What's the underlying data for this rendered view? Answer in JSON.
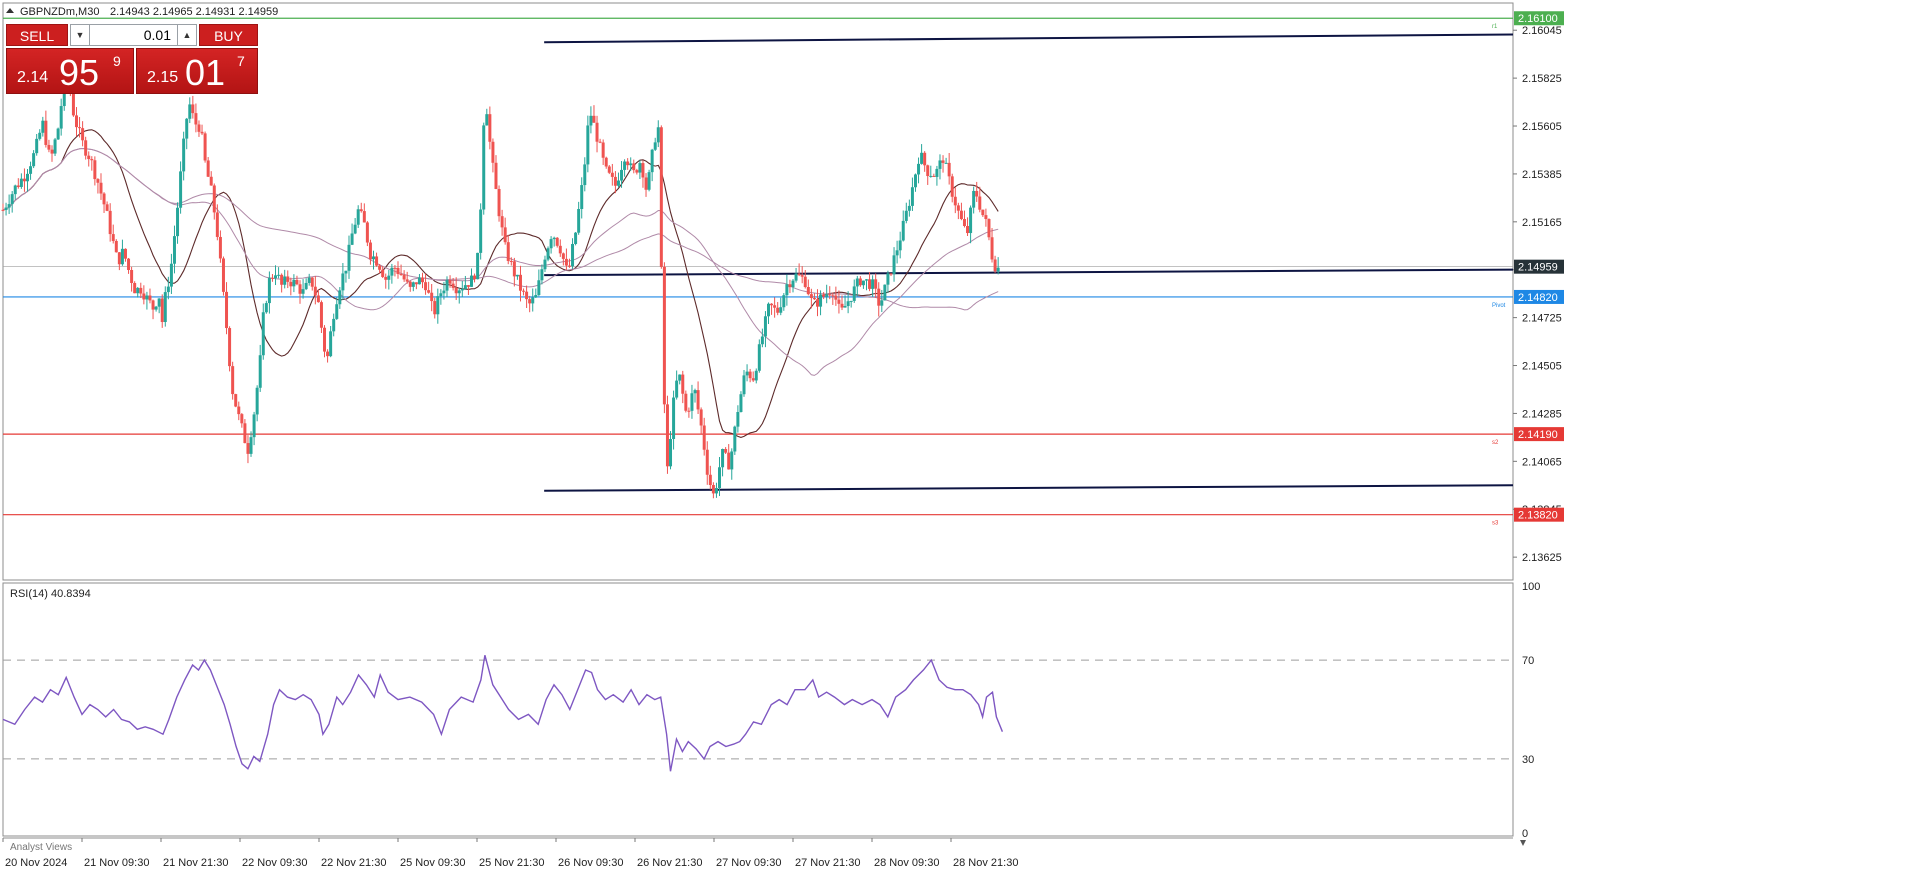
{
  "header": {
    "symbol": "GBPNZDm,M30",
    "ohlc": "2.14943 2.14965 2.14931 2.14959"
  },
  "trade_panel": {
    "sell_label": "SELL",
    "buy_label": "BUY",
    "lot": "0.01",
    "bid_small": "2.14",
    "bid_big": "95",
    "bid_sup": "9",
    "ask_small": "2.15",
    "ask_big": "01",
    "ask_sup": "7"
  },
  "indicator_label": "RSI(14) 40.8394",
  "bottom_tab": "Analyst Views",
  "colors": {
    "bull": "#26a69a",
    "bear": "#ef5350",
    "level_green": "#4caf50",
    "level_blue": "#1e88e5",
    "level_red": "#e53935",
    "channel": "#0d1442",
    "rsi": "#7e57c2",
    "ma_dark": "#5d2a2a",
    "ma_light": "#b08aa8"
  },
  "chart_data": [
    {
      "type": "candlestick",
      "x": [
        "20 Nov 2024",
        "21 Nov 09:30",
        "21 Nov 21:30",
        "22 Nov 09:30",
        "22 Nov 21:30",
        "25 Nov 09:30",
        "25 Nov 21:30",
        "26 Nov 09:30",
        "26 Nov 21:30",
        "27 Nov 09:30",
        "27 Nov 21:30",
        "28 Nov 09:30",
        "28 Nov 21:30"
      ],
      "ylim": [
        2.1352,
        2.1617
      ],
      "y_ticks": [
        "2.16045",
        "2.15825",
        "2.15605",
        "2.15385",
        "2.15165",
        "2.14945",
        "2.14725",
        "2.14505",
        "2.14285",
        "2.14065",
        "2.13845",
        "2.13625"
      ],
      "last_price": 2.14959,
      "levels": [
        {
          "label": "2.16100",
          "value": 2.161,
          "color": "#4caf50",
          "tag": "r1"
        },
        {
          "label": "2.14820",
          "value": 2.1482,
          "color": "#1e88e5",
          "tag": "Pivot"
        },
        {
          "label": "2.14190",
          "value": 2.1419,
          "color": "#e53935",
          "tag": "s2"
        },
        {
          "label": "2.13820",
          "value": 2.1382,
          "color": "#e53935",
          "tag": "s3"
        }
      ],
      "channel_lines": [
        {
          "from": [
            13.7,
            2.1599
          ],
          "to": [
            62,
            2.1606
          ]
        },
        {
          "from": [
            13.7,
            2.1492
          ],
          "to": [
            62,
            2.1497
          ]
        },
        {
          "from": [
            13.7,
            2.1393
          ],
          "to": [
            62,
            2.1398
          ]
        }
      ],
      "path": [
        [
          0,
          2.1522
        ],
        [
          0.3,
          2.1532
        ],
        [
          0.55,
          2.1538
        ],
        [
          0.8,
          2.1548
        ],
        [
          1,
          2.1562
        ],
        [
          1.2,
          2.1544
        ],
        [
          1.4,
          2.156
        ],
        [
          1.6,
          2.1588
        ],
        [
          1.8,
          2.1565
        ],
        [
          2,
          2.1553
        ],
        [
          2.2,
          2.1546
        ],
        [
          2.4,
          2.1535
        ],
        [
          2.6,
          2.1522
        ],
        [
          2.75,
          2.151
        ],
        [
          2.9,
          2.1498
        ],
        [
          3.05,
          2.1503
        ],
        [
          3.2,
          2.1493
        ],
        [
          3.35,
          2.1485
        ],
        [
          3.5,
          2.1486
        ],
        [
          3.65,
          2.1481
        ],
        [
          3.8,
          2.1477
        ],
        [
          3.95,
          2.1483
        ],
        [
          4.05,
          2.1468
        ],
        [
          4.1,
          2.1481
        ],
        [
          4.25,
          2.1495
        ],
        [
          4.4,
          2.152
        ],
        [
          4.55,
          2.1548
        ],
        [
          4.7,
          2.1572
        ],
        [
          4.85,
          2.1562
        ],
        [
          5,
          2.156
        ],
        [
          5.1,
          2.1545
        ],
        [
          5.3,
          2.1528
        ],
        [
          5.45,
          2.1508
        ],
        [
          5.55,
          2.1488
        ],
        [
          5.65,
          2.147
        ],
        [
          5.8,
          2.144
        ],
        [
          5.95,
          2.1428
        ],
        [
          6.1,
          2.1418
        ],
        [
          6.2,
          2.1412
        ],
        [
          6.35,
          2.1428
        ],
        [
          6.5,
          2.145
        ],
        [
          6.6,
          2.1475
        ],
        [
          6.75,
          2.149
        ],
        [
          6.9,
          2.1494
        ],
        [
          7.05,
          2.1487
        ],
        [
          7.2,
          2.149
        ],
        [
          7.4,
          2.1488
        ],
        [
          7.6,
          2.1484
        ],
        [
          7.8,
          2.149
        ],
        [
          8,
          2.1478
        ],
        [
          8.1,
          2.1462
        ],
        [
          8.2,
          2.1452
        ],
        [
          8.35,
          2.1473
        ],
        [
          8.5,
          2.1486
        ],
        [
          8.7,
          2.1497
        ],
        [
          8.85,
          2.1512
        ],
        [
          9,
          2.1522
        ],
        [
          9.15,
          2.1515
        ],
        [
          9.3,
          2.1502
        ],
        [
          9.5,
          2.1498
        ],
        [
          9.7,
          2.149
        ],
        [
          9.9,
          2.1496
        ],
        [
          10.1,
          2.1492
        ],
        [
          10.3,
          2.1485
        ],
        [
          10.5,
          2.149
        ],
        [
          10.7,
          2.1488
        ],
        [
          10.9,
          2.1474
        ],
        [
          11.1,
          2.1485
        ],
        [
          11.3,
          2.1491
        ],
        [
          11.5,
          2.1486
        ],
        [
          11.7,
          2.1488
        ],
        [
          11.9,
          2.149
        ],
        [
          12.05,
          2.1502
        ],
        [
          12.2,
          2.1578
        ],
        [
          12.35,
          2.1548
        ],
        [
          12.5,
          2.1528
        ],
        [
          12.7,
          2.1505
        ],
        [
          12.9,
          2.1495
        ],
        [
          13.1,
          2.1486
        ],
        [
          13.3,
          2.1478
        ],
        [
          13.5,
          2.1482
        ],
        [
          13.7,
          2.15
        ],
        [
          13.9,
          2.1512
        ],
        [
          14.1,
          2.1505
        ],
        [
          14.3,
          2.1492
        ],
        [
          14.5,
          2.1512
        ],
        [
          14.7,
          2.1538
        ],
        [
          14.85,
          2.1568
        ],
        [
          15.05,
          2.1555
        ],
        [
          15.25,
          2.154
        ],
        [
          15.5,
          2.1533
        ],
        [
          15.75,
          2.1548
        ],
        [
          15.95,
          2.1538
        ],
        [
          16.15,
          2.1545
        ],
        [
          16.3,
          2.153
        ],
        [
          16.5,
          2.1555
        ],
        [
          16.6,
          2.156
        ],
        [
          16.7,
          2.146
        ],
        [
          16.8,
          2.1398
        ],
        [
          16.95,
          2.143
        ],
        [
          17.1,
          2.1448
        ],
        [
          17.3,
          2.1428
        ],
        [
          17.5,
          2.144
        ],
        [
          17.7,
          2.142
        ],
        [
          17.85,
          2.14
        ],
        [
          18,
          2.139
        ],
        [
          18.2,
          2.141
        ],
        [
          18.4,
          2.1405
        ],
        [
          18.6,
          2.143
        ],
        [
          18.8,
          2.1448
        ],
        [
          19,
          2.1445
        ],
        [
          19.2,
          2.1462
        ],
        [
          19.4,
          2.1478
        ],
        [
          19.6,
          2.1475
        ],
        [
          19.85,
          2.1488
        ],
        [
          20.05,
          2.1492
        ],
        [
          20.3,
          2.149
        ],
        [
          20.5,
          2.1478
        ],
        [
          20.75,
          2.1482
        ],
        [
          21,
          2.1486
        ],
        [
          21.2,
          2.1474
        ],
        [
          21.45,
          2.1482
        ],
        [
          21.7,
          2.149
        ],
        [
          22,
          2.1488
        ],
        [
          22.2,
          2.1478
        ],
        [
          22.4,
          2.149
        ],
        [
          22.6,
          2.1502
        ],
        [
          22.8,
          2.1515
        ],
        [
          23,
          2.153
        ],
        [
          23.2,
          2.1548
        ],
        [
          23.4,
          2.154
        ],
        [
          23.6,
          2.1538
        ],
        [
          23.8,
          2.1546
        ],
        [
          24,
          2.1532
        ],
        [
          24.2,
          2.152
        ],
        [
          24.4,
          2.151
        ],
        [
          24.6,
          2.1532
        ],
        [
          24.8,
          2.152
        ],
        [
          24.9,
          2.1515
        ],
        [
          25.05,
          2.15
        ],
        [
          25.15,
          2.1495
        ],
        [
          25.3,
          2.1496
        ]
      ]
    },
    {
      "type": "line",
      "title": "RSI(14) 40.8394",
      "ylim": [
        0,
        100
      ],
      "y_ticks": [
        100,
        70,
        30,
        0
      ],
      "levels": [
        70,
        30
      ],
      "series": [
        {
          "values": [
            [
              0,
              46
            ],
            [
              0.3,
              44
            ],
            [
              0.55,
              50
            ],
            [
              0.8,
              55
            ],
            [
              1,
              53
            ],
            [
              1.2,
              58
            ],
            [
              1.4,
              56
            ],
            [
              1.6,
              63
            ],
            [
              1.8,
              55
            ],
            [
              2,
              48
            ],
            [
              2.2,
              52
            ],
            [
              2.4,
              50
            ],
            [
              2.6,
              47
            ],
            [
              2.8,
              50
            ],
            [
              3,
              46
            ],
            [
              3.2,
              45
            ],
            [
              3.4,
              42
            ],
            [
              3.6,
              43
            ],
            [
              3.8,
              42
            ],
            [
              4.05,
              40
            ],
            [
              4.2,
              46
            ],
            [
              4.4,
              55
            ],
            [
              4.6,
              62
            ],
            [
              4.8,
              68
            ],
            [
              4.95,
              66
            ],
            [
              5.1,
              70
            ],
            [
              5.25,
              66
            ],
            [
              5.4,
              60
            ],
            [
              5.6,
              52
            ],
            [
              5.75,
              44
            ],
            [
              5.9,
              35
            ],
            [
              6.05,
              28
            ],
            [
              6.2,
              26
            ],
            [
              6.35,
              31
            ],
            [
              6.5,
              29
            ],
            [
              6.7,
              40
            ],
            [
              6.85,
              52
            ],
            [
              7,
              58
            ],
            [
              7.2,
              55
            ],
            [
              7.4,
              54
            ],
            [
              7.6,
              56
            ],
            [
              7.8,
              54
            ],
            [
              8,
              48
            ],
            [
              8.1,
              40
            ],
            [
              8.25,
              44
            ],
            [
              8.45,
              55
            ],
            [
              8.6,
              52
            ],
            [
              8.8,
              57
            ],
            [
              9,
              64
            ],
            [
              9.2,
              60
            ],
            [
              9.4,
              55
            ],
            [
              9.55,
              64
            ],
            [
              9.75,
              57
            ],
            [
              10,
              54
            ],
            [
              10.3,
              55
            ],
            [
              10.6,
              53
            ],
            [
              10.9,
              48
            ],
            [
              11.1,
              40
            ],
            [
              11.3,
              50
            ],
            [
              11.6,
              55
            ],
            [
              11.9,
              53
            ],
            [
              12.1,
              62
            ],
            [
              12.2,
              72
            ],
            [
              12.4,
              60
            ],
            [
              12.6,
              55
            ],
            [
              12.8,
              50
            ],
            [
              13.05,
              46
            ],
            [
              13.3,
              48
            ],
            [
              13.55,
              44
            ],
            [
              13.75,
              54
            ],
            [
              13.95,
              60
            ],
            [
              14.15,
              56
            ],
            [
              14.35,
              50
            ],
            [
              14.55,
              58
            ],
            [
              14.75,
              66
            ],
            [
              14.9,
              65
            ],
            [
              15.05,
              58
            ],
            [
              15.25,
              54
            ],
            [
              15.45,
              56
            ],
            [
              15.7,
              53
            ],
            [
              15.9,
              58
            ],
            [
              16.1,
              52
            ],
            [
              16.3,
              56
            ],
            [
              16.5,
              54
            ],
            [
              16.65,
              55
            ],
            [
              16.8,
              40
            ],
            [
              16.9,
              25
            ],
            [
              17.05,
              38
            ],
            [
              17.2,
              33
            ],
            [
              17.35,
              37
            ],
            [
              17.55,
              34
            ],
            [
              17.75,
              30
            ],
            [
              17.9,
              35
            ],
            [
              18.1,
              37
            ],
            [
              18.3,
              35
            ],
            [
              18.5,
              36
            ],
            [
              18.65,
              37
            ],
            [
              18.8,
              40
            ],
            [
              19,
              45
            ],
            [
              19.2,
              44
            ],
            [
              19.45,
              52
            ],
            [
              19.65,
              54
            ],
            [
              19.85,
              52
            ],
            [
              20.05,
              58
            ],
            [
              20.3,
              58
            ],
            [
              20.5,
              62
            ],
            [
              20.65,
              55
            ],
            [
              20.85,
              57
            ],
            [
              21.05,
              55
            ],
            [
              21.3,
              52
            ],
            [
              21.5,
              54
            ],
            [
              21.75,
              52
            ],
            [
              22,
              54
            ],
            [
              22.2,
              52
            ],
            [
              22.4,
              47
            ],
            [
              22.6,
              55
            ],
            [
              22.85,
              58
            ],
            [
              23.05,
              62
            ],
            [
              23.3,
              66
            ],
            [
              23.5,
              70
            ],
            [
              23.7,
              62
            ],
            [
              23.9,
              59
            ],
            [
              24.1,
              58
            ],
            [
              24.3,
              58
            ],
            [
              24.5,
              56
            ],
            [
              24.7,
              52
            ],
            [
              24.8,
              47
            ],
            [
              24.9,
              55
            ],
            [
              25.05,
              57
            ],
            [
              25.15,
              47
            ],
            [
              25.3,
              41
            ]
          ]
        }
      ]
    }
  ]
}
